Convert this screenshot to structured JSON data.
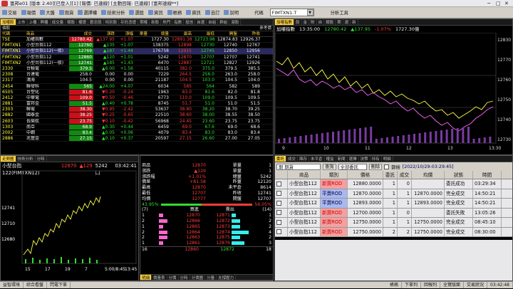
{
  "titlebar": {
    "text": "富邦e01 [版本 2.40][已登入][1] [報價: 已連線] [主動回報: 已連線] [富邦連線**]"
  },
  "menu": [
    "交易",
    "報價",
    "大盤",
    "期貨",
    "選擇權",
    "技術分析",
    "選股",
    "資訊",
    "帳務",
    "資訊",
    "自訂",
    "說明"
  ],
  "menu_extra": "代碼",
  "symbol_box": "FIMTXN1.T",
  "menu_right": "分析工具",
  "qt_tabs": [
    "加權股",
    "上市",
    "上櫃",
    "興櫃",
    "成交量",
    "類股",
    "權證",
    "觀念股",
    "特別股",
    "存託憑證",
    "期權",
    "新股",
    "熱門",
    "指數",
    "投信",
    "自選",
    "自組",
    "群組",
    "港股"
  ],
  "qt_columns": [
    "代碼",
    "商品",
    "成交",
    "漲跌",
    "漲幅",
    "單量",
    "總量",
    "最高",
    "最低",
    "開盤",
    "昨收"
  ],
  "qt_header_title": "個股",
  "qt_header_right": "參考價",
  "quotes": [
    [
      "TSE",
      "加權指數",
      "12780.42",
      "▲137.95",
      "+1.07",
      "",
      "1727.30",
      "12891.38",
      "12723.98",
      "12874.83",
      "12926.37",
      "r"
    ],
    [
      "FIMTXN1",
      "小型台指112",
      "12760",
      "▲135",
      "+1.07",
      "",
      "138375",
      "12898",
      "12730",
      "12740",
      "12767",
      "g"
    ],
    [
      "FIMTXN1",
      "小型台指112(一般)",
      "12769",
      "▲187",
      "+1.44",
      "",
      "176758",
      "12915",
      "12745",
      "12850",
      "12956",
      "gs"
    ],
    [
      "FIMTXN2",
      "小型台指112",
      "12860",
      "▲120",
      "+1.01",
      "",
      "5242",
      "12870",
      "12707",
      "12707",
      "12741",
      "g"
    ],
    [
      "FIMTXN2",
      "小型台指112(一般)",
      "12741",
      "▲185",
      "+1.43",
      "",
      "6470",
      "12887",
      "12721",
      "12827",
      "12926",
      "g"
    ],
    [
      "2330",
      "台積電",
      "379.5",
      "▲6.00",
      "+1.56",
      "",
      "40115",
      "382.0",
      "375.0",
      "379.5",
      "385.5",
      "g"
    ],
    [
      "2308",
      "台達電",
      "258.0",
      "0.00",
      "0.00",
      "",
      "7229",
      "264.5",
      "256.0",
      "263.0",
      "258.0",
      "w"
    ],
    [
      "2317",
      "鴻海",
      "104.5",
      "0.00",
      "0.00",
      "",
      "21187",
      "104.5",
      "103.0",
      "104.5",
      "104.0",
      "w"
    ],
    [
      "2454",
      "聯發科",
      "565",
      "▲24.00",
      "+4.07",
      "",
      "6034",
      "585",
      "564",
      "582",
      "589",
      "g"
    ],
    [
      "6505",
      "台塑化",
      "81.6",
      "▼0.20",
      "-0.24",
      "",
      "1963",
      "83.0",
      "81.6",
      "82.0",
      "81.8",
      "r"
    ],
    [
      "2412",
      "中華電",
      "109.0",
      "▼0.50",
      "-0.46",
      "",
      "6773",
      "110.0",
      "109.0",
      "109.5",
      "109.5",
      "r"
    ],
    [
      "2881",
      "富邦金",
      "51.5",
      "▲0.40",
      "+0.78",
      "",
      "8745",
      "51.7",
      "51.0",
      "51.0",
      "51.5",
      "g"
    ],
    [
      "2303",
      "聯電",
      "38.30",
      "▼0.95",
      "-2.42",
      "",
      "53637",
      "38.80",
      "38.20",
      "38.70",
      "39.25",
      "r"
    ],
    [
      "2882",
      "國泰金",
      "38.25",
      "▼0.25",
      "-0.65",
      "",
      "22510",
      "38.60",
      "38.00",
      "38.55",
      "38.50",
      "r"
    ],
    [
      "2603",
      "長榮航",
      "23.75",
      "▼0.10",
      "-0.42",
      "",
      "56968",
      "24.45",
      "23.60",
      "23.75",
      "23.75",
      "r"
    ],
    [
      "1303",
      "南亞",
      "68.9",
      "▲0.30",
      "+0.44",
      "",
      "6459",
      "69.0",
      "67.6",
      "69.0",
      "68.6",
      "g"
    ],
    [
      "2002",
      "中鋼",
      "83.4",
      "▲0.05",
      "+0.06",
      "",
      "4079",
      "83.4",
      "83.0",
      "83.0",
      "83.4",
      "g"
    ],
    [
      "2886",
      "兆豐金",
      "27.15",
      "▲0.10",
      "+0.37",
      "",
      "20597",
      "27.15",
      "26.60",
      "27.00",
      "27.05",
      "g"
    ]
  ],
  "rc_tabs": [
    "加權指數",
    "股",
    "金",
    "財",
    "自",
    "類股",
    "期",
    "選",
    "新"
  ],
  "rc_info": {
    "name": "加權指數",
    "time": "13:35:00",
    "price": "12780.42",
    "change": "▲137.95",
    "pct": "-1.07%",
    "vol": "1727.30億"
  },
  "rc_axis": {
    "y": [
      "12830",
      "12770",
      "12760",
      "12750",
      "12740",
      "12730"
    ],
    "x": [
      "9",
      "10",
      "11",
      "12",
      "13",
      "13:30"
    ]
  },
  "bl_tabs": [
    "走勢圖",
    "技術分析",
    "分時"
  ],
  "bl_info": {
    "name": "小型台指122(FIMTXN12)",
    "price": "12870",
    "change": "▲129",
    "vol": "5242口",
    "time": "03:42:41"
  },
  "bl_axis": {
    "y": [
      "12741",
      "12710",
      "12680"
    ],
    "x": [
      "15",
      "17",
      "19",
      "7",
      "5:00/8:45",
      "13:45"
    ]
  },
  "sm_rows": [
    {
      "l": "商品",
      "v": "12870",
      "l2": "單量",
      "v2": "1"
    },
    {
      "l": "漲跌",
      "v": "▲129",
      "l2": "單量",
      "v2": "1"
    },
    {
      "l": "漲跌幅",
      "v": "+1.01%",
      "l2": "總量",
      "v2": "5242"
    },
    {
      "l": "價差",
      "v": "+81.58",
      "l2": "昨量",
      "v2": "12120"
    },
    {
      "l": "最高",
      "v": "12870",
      "l2": "未平倉",
      "v2": "8614"
    },
    {
      "l": "最低",
      "v": "12707",
      "l2": "昨收",
      "v2": "12741"
    },
    {
      "l": "均價",
      "v": "12777",
      "l2": "開盤",
      "v2": "12707"
    }
  ],
  "sm_ratio": {
    "left": "43.95%",
    "right": "56.05%"
  },
  "book_head": {
    "l": "(7)",
    "bid": "買進",
    "ask": "賣出",
    "r": "(14)"
  },
  "book": [
    {
      "bq": "1",
      "bp": "12870",
      "ap": "12871",
      "aq": "1"
    },
    {
      "bq": "2",
      "bp": "12866",
      "ap": "12872",
      "aq": "2"
    },
    {
      "bq": "1",
      "bp": "12865",
      "ap": "12873",
      "aq": "2"
    },
    {
      "bq": "2",
      "bp": "12864",
      "ap": "12874",
      "aq": "4"
    },
    {
      "bq": "2",
      "bp": "12863",
      "ap": "12875",
      "aq": "2"
    },
    {
      "bq": "1",
      "bp": "12861",
      "ap": "12876",
      "aq": "3"
    }
  ],
  "book_total": {
    "l": "16",
    "bp": "12860",
    "ap": "12872",
    "r": "18"
  },
  "sm_tabs": [
    "明細",
    "價量表",
    "分價",
    "分時",
    "分價圖",
    "分量",
    "支撐壓力"
  ],
  "od_tabs": [
    "委託",
    "成交",
    "庫存",
    "未平倉",
    "權益",
    "新聞",
    "選擇",
    "決策",
    "持有",
    "明細"
  ],
  "od_toolbar": {
    "account": "期 期貨",
    "query": "查詢",
    "filter": "全部委託",
    "cancel": "刪除",
    "chk": "篩檢",
    "date": "[2022/10/29-03:29:45]"
  },
  "od_columns": [
    "",
    "商品",
    "類別",
    "價格",
    "委託",
    "成交",
    "均價",
    "狀態",
    "時間"
  ],
  "orders": [
    {
      "p": "小型台指112",
      "t": "新買ROD",
      "pr": "12880.0000",
      "q": "1",
      "f": "0",
      "avg": "",
      "st": "委託成功",
      "tm": "03:29:34",
      "c": "r"
    },
    {
      "p": "小型台指112",
      "t": "平賣ROD",
      "pr": "12870.0000",
      "q": "1",
      "f": "1",
      "avg": "12870.0000",
      "st": "完全成交",
      "tm": "14:50:21",
      "c": "b"
    },
    {
      "p": "小型台指112",
      "t": "平賣ROD",
      "pr": "12893.0000",
      "q": "1",
      "f": "1",
      "avg": "12893.0000",
      "st": "完全成交",
      "tm": "14:50:21",
      "c": "b"
    },
    {
      "p": "小型台指112",
      "t": "新買ROD",
      "pr": "12700.0000",
      "q": "1",
      "f": "0",
      "avg": "",
      "st": "委託失敗",
      "tm": "13:05:26",
      "c": "r"
    },
    {
      "p": "小型台指112",
      "t": "新賣ROD",
      "pr": "12750.0000",
      "q": "1",
      "f": "1",
      "avg": "12750.0000",
      "st": "完全成交",
      "tm": "08:45:10",
      "c": "r"
    },
    {
      "p": "小型台指112",
      "t": "新賣ROD",
      "pr": "12750.0000",
      "q": "2",
      "f": "2",
      "avg": "12750.0000",
      "st": "完全成交",
      "tm": "08:30:00",
      "c": "r"
    }
  ],
  "status": [
    "益智環境",
    "綜合看盤",
    "閃電下單"
  ],
  "status_right": [
    "帳務",
    "下單列",
    "回報列",
    "全覽版面",
    "交易狀況",
    "03:42:48"
  ],
  "colors": {
    "up": "#ff3b3b",
    "down": "#2fe02f",
    "accent": "#ffd23a"
  }
}
